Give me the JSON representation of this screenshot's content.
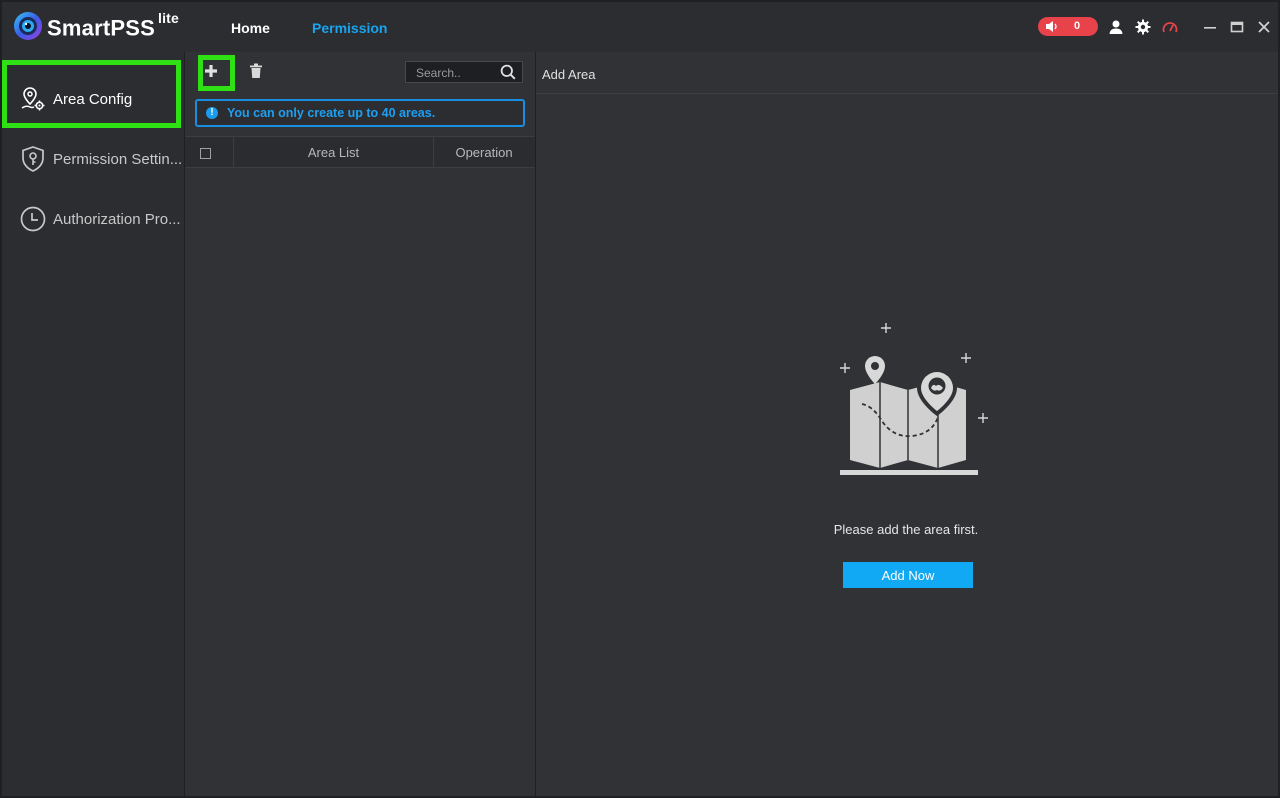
{
  "app": {
    "name": "SmartPSS",
    "edition": "lite"
  },
  "nav": {
    "home_label": "Home",
    "permission_label": "Permission"
  },
  "header": {
    "alarm_count": "0"
  },
  "sidebar": {
    "items": [
      {
        "label": "Area Config",
        "icon": "area-config-icon",
        "active": true
      },
      {
        "label": "Permission Settin...",
        "icon": "shield-key-icon",
        "active": false
      },
      {
        "label": "Authorization Pro...",
        "icon": "clock-icon",
        "active": false
      }
    ]
  },
  "list_panel": {
    "search_placeholder": "Search..",
    "notice": "You can only create up to 40 areas.",
    "columns": [
      "Area List",
      "Operation"
    ]
  },
  "detail_panel": {
    "title": "Add Area",
    "empty_message": "Please add the area first.",
    "add_now_label": "Add Now"
  },
  "colors": {
    "accent": "#1aa3ef",
    "button": "#11a9f3",
    "alarm": "#e8434b",
    "highlight": "#2fe014"
  }
}
